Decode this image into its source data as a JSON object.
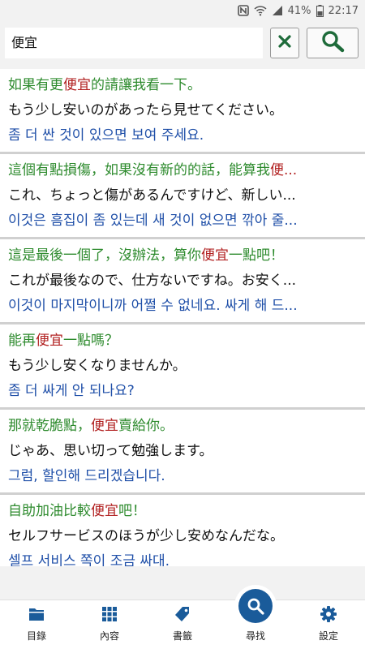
{
  "status": {
    "battery": "41%",
    "time": "22:17"
  },
  "search": {
    "value": "便宜"
  },
  "results": [
    {
      "zh_before": "如果有更",
      "zh_hl": "便宜",
      "zh_after": "的請讓我看一下。",
      "ja": "もう少し安いのがあったら見せてください。",
      "ko": "좀 더 싼 것이 있으면 보여 주세요."
    },
    {
      "zh_before": "這個有點損傷，如果沒有新的的話，能算我",
      "zh_hl": "便...",
      "zh_after": "",
      "ja": "これ、ちょっと傷があるんですけど、新しい...",
      "ko": "이것은 흠집이 좀 있는데 새 것이 없으면 깎아 줄..."
    },
    {
      "zh_before": "這是最後一個了，沒辦法，算你",
      "zh_hl": "便宜",
      "zh_after": "一點吧！",
      "ja": "これが最後なので、仕方ないですね。お安く...",
      "ko": "이것이 마지막이니까 어쩔 수 없네요. 싸게 해 드..."
    },
    {
      "zh_before": "能再",
      "zh_hl": "便宜",
      "zh_after": "一點嗎？",
      "ja": "もう少し安くなりませんか。",
      "ko": "좀 더 싸게 안 되나요?"
    },
    {
      "zh_before": "那就乾脆點，",
      "zh_hl": "便宜",
      "zh_after": "賣給你。",
      "ja": "じゃあ、思い切って勉強します。",
      "ko": "그럼, 할인해 드리겠습니다."
    },
    {
      "zh_before": "自助加油比較",
      "zh_hl": "便宜",
      "zh_after": "吧！",
      "ja": "セルフサービスのほうが少し安めなんだな。",
      "ko": "셀프 서비스 쪽이 조금 싸대."
    }
  ],
  "nav": {
    "catalog": "目錄",
    "content": "內容",
    "bookmark": "書籤",
    "search": "尋找",
    "settings": "設定"
  },
  "colors": {
    "chinese": "#2e8b2e",
    "highlight": "#b22222",
    "korean": "#1f4fa8",
    "accent": "#1a5b9a",
    "buttonIcon": "#1e6b3a"
  },
  "icons": [
    "nfc-icon",
    "wifi-icon",
    "signal-icon",
    "battery-icon",
    "clear-icon",
    "search-icon",
    "folder-icon",
    "grid-icon",
    "tag-icon",
    "gear-icon"
  ]
}
